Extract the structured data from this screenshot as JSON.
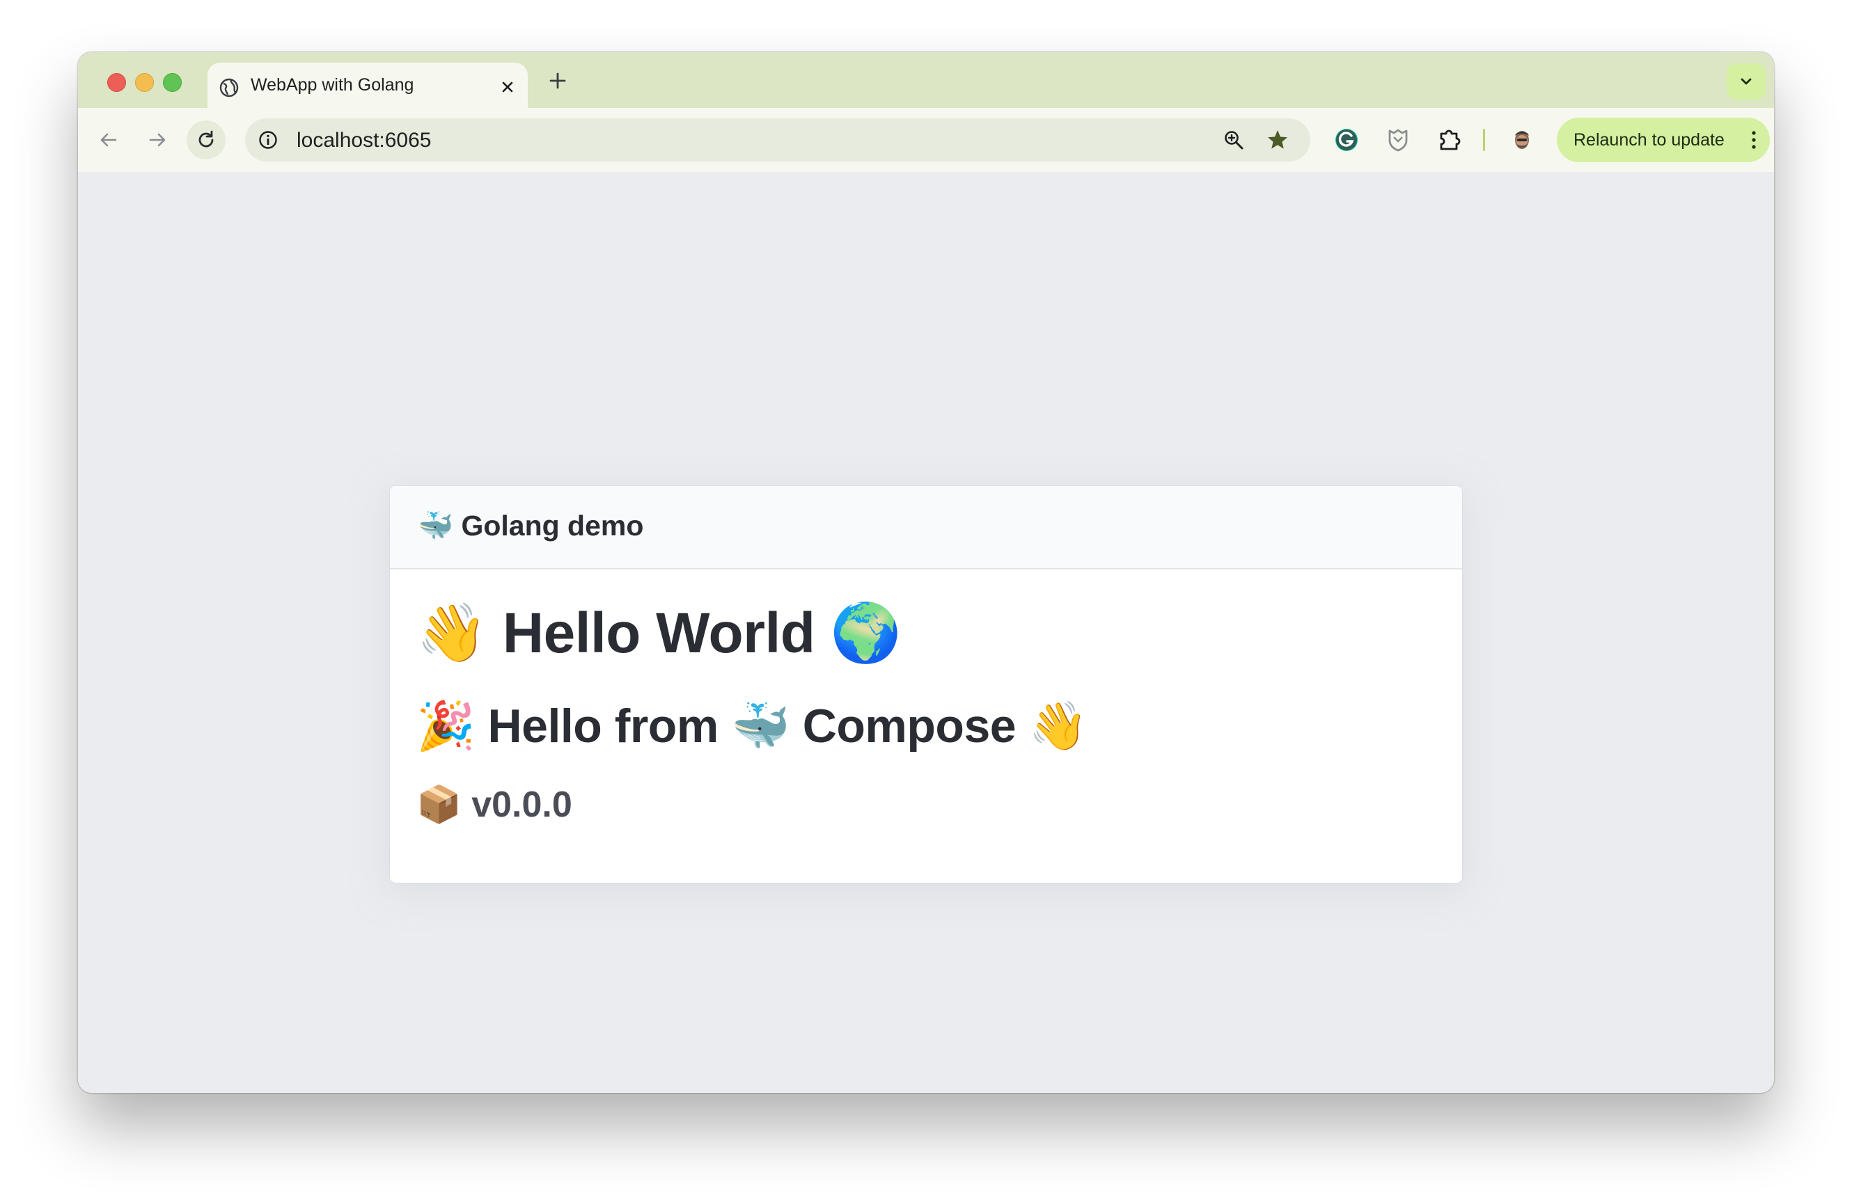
{
  "browser": {
    "tab_title": "WebApp with Golang",
    "url": "localhost:6065",
    "relaunch_label": "Relaunch to update",
    "icons": {
      "tab_favicon": "globe-icon",
      "tab_close": "close-icon",
      "new_tab": "plus-icon",
      "tab_search": "chevron-down-icon",
      "back": "arrow-left-icon",
      "forward": "arrow-right-icon",
      "reload": "reload-icon",
      "site_info": "info-icon",
      "zoom": "zoom-in-icon",
      "bookmark": "star-icon",
      "extensions": [
        "grammarly-icon",
        "shield-extension-icon",
        "puzzle-icon"
      ],
      "profile": "avatar-icon",
      "menu": "more-vert-icon"
    },
    "colors": {
      "frame": "#dce5c4",
      "toolbar": "#f6f8ef",
      "accent_button": "#d4f0a0"
    }
  },
  "page": {
    "card_title": "🐳 Golang demo",
    "heading_hello": "👋 Hello World 🌍",
    "heading_compose": "🎉 Hello from 🐳 Compose 👋",
    "version": "📦 v0.0.0",
    "colors": {
      "background": "#ebecef",
      "card": "#ffffff",
      "text": "#2a2d33"
    }
  }
}
